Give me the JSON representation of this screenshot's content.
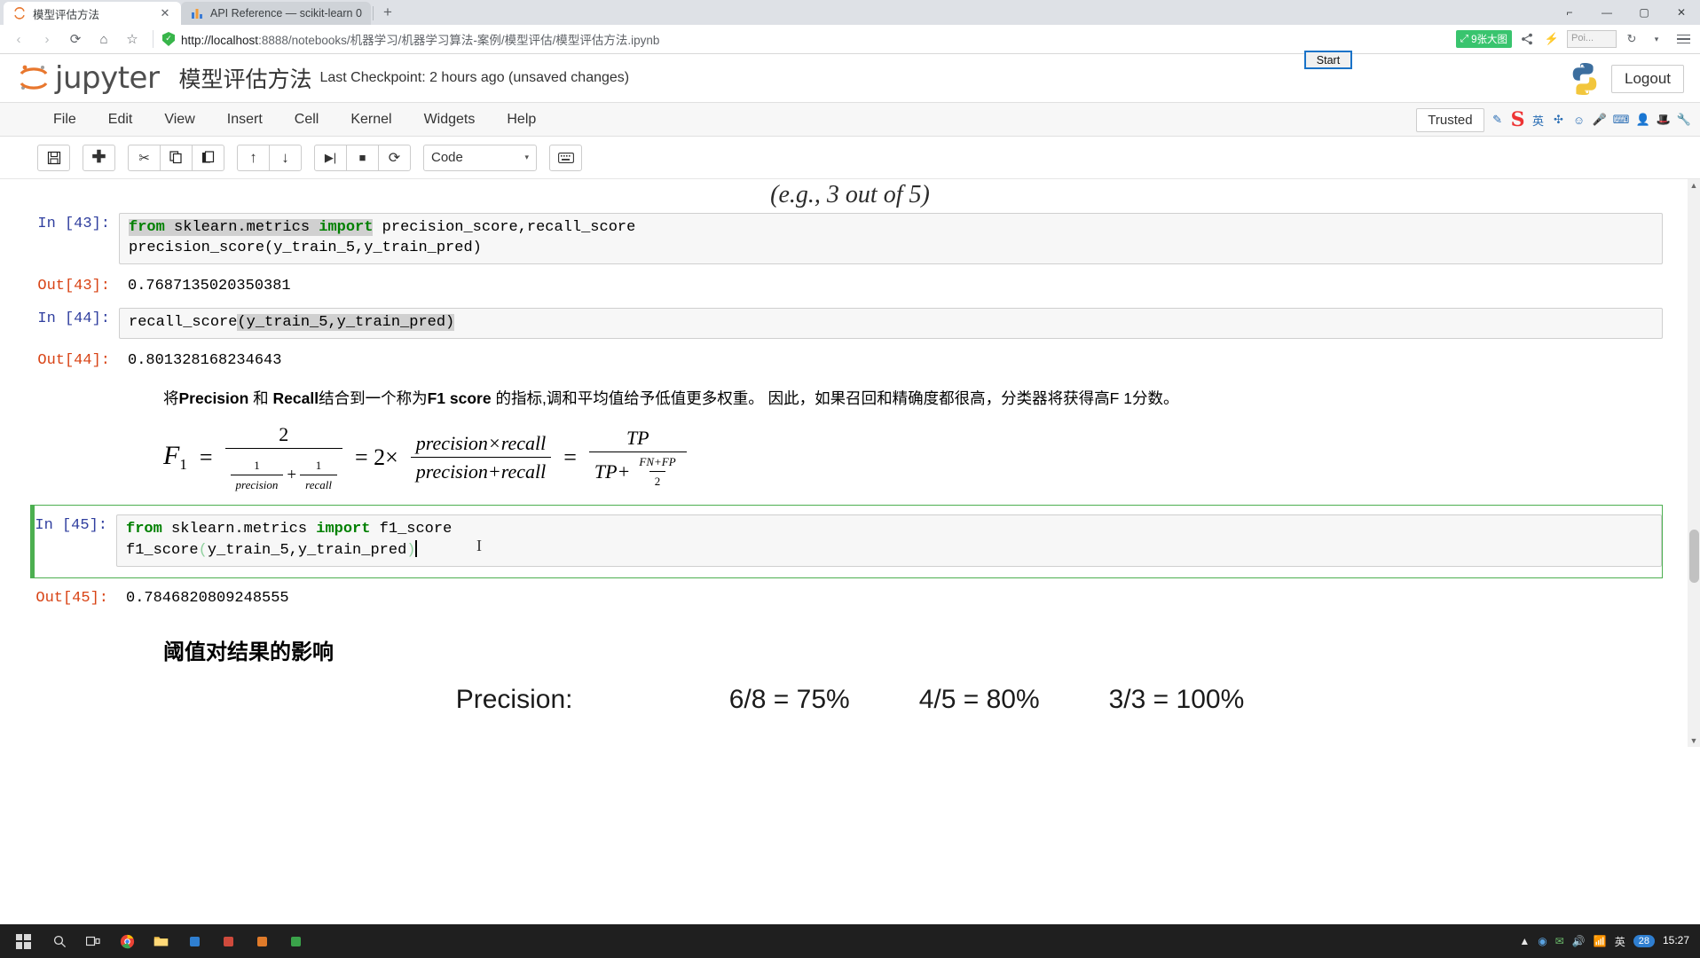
{
  "browser": {
    "tabs": [
      {
        "title": "模型评估方法",
        "favicon": "jupyter-icon",
        "active": true,
        "close_label": "✕"
      },
      {
        "title": "API Reference — scikit-learn 0",
        "favicon": "chart-icon",
        "active": false,
        "close_label": ""
      }
    ],
    "new_tab_label": "+",
    "window_buttons": {
      "minimize": "—",
      "maximize": "▢",
      "close": "✕",
      "restore": "⌐"
    },
    "nav": {
      "back": "‹",
      "forward": "›",
      "reload": "⟳",
      "home": "⌂",
      "bookmark": "☆"
    },
    "address": {
      "security_icon": "shield-check-icon",
      "host": "http://localhost",
      "rest": ":8888/notebooks/机器学习/机器学习算法-案例/模型评估/模型评估方法.ipynb",
      "full_url": "http://localhost:8888/notebooks/机器学习/机器学习算法-案例/模型评估/模型评估方法.ipynb"
    },
    "toolbar_right": {
      "capture_badge": "9张大图",
      "capture_icon": "expand-icon",
      "share_icon": "share-icon",
      "flash_icon": "lightning-icon",
      "poi_text": "Poi...",
      "history_icon": "history-icon",
      "menu_icon": "hamburger-menu-icon"
    }
  },
  "overlay": {
    "start_button": "Start"
  },
  "jupyter": {
    "logo_text": "jupyter",
    "notebook_title": "模型评估方法",
    "checkpoint": "Last Checkpoint: 2 hours ago (unsaved changes)",
    "logout_label": "Logout",
    "menus": [
      "File",
      "Edit",
      "View",
      "Insert",
      "Cell",
      "Kernel",
      "Widgets",
      "Help"
    ],
    "trusted_label": "Trusted",
    "kernel_icon": "python-logo-icon",
    "toolbar": {
      "buttons": [
        {
          "name": "save-button",
          "glyph": "💾",
          "title": "Save"
        },
        {
          "name": "insert-cell-button",
          "glyph": "✚",
          "title": "Insert cell below"
        },
        {
          "name": "cut-cell-button",
          "glyph": "✂",
          "title": "Cut"
        },
        {
          "name": "copy-cell-button",
          "glyph": "⧉",
          "title": "Copy"
        },
        {
          "name": "paste-cell-button",
          "glyph": "📋",
          "title": "Paste"
        },
        {
          "name": "move-up-button",
          "glyph": "↑",
          "title": "Move up"
        },
        {
          "name": "move-down-button",
          "glyph": "↓",
          "title": "Move down"
        },
        {
          "name": "run-cell-button",
          "glyph": "▶|",
          "title": "Run"
        },
        {
          "name": "interrupt-kernel-button",
          "glyph": "■",
          "title": "Interrupt"
        },
        {
          "name": "restart-kernel-button",
          "glyph": "⟳",
          "title": "Restart"
        }
      ],
      "cell_type": "Code",
      "caret": "▾",
      "keyboard_icon": "keyboard-icon"
    },
    "ime": {
      "logo": "S",
      "lang": "英",
      "items": [
        "✣",
        "☺",
        "🎤",
        "⌨",
        "👤",
        "🎩",
        "🔧"
      ]
    }
  },
  "notebook": {
    "top_fragment": "(e.g., 3 out of 5)",
    "cells": [
      {
        "id": "cell-43",
        "prompt_in": "In [43]:",
        "prompt_out": "Out[43]:",
        "code_line1_kw1": "from",
        "code_line1_mid": " sklearn.metrics ",
        "code_line1_kw2": "import",
        "code_line1_tail": " precision_score,recall_score",
        "code_line2": "precision_score(y_train_5,y_train_pred)",
        "output": "0.7687135020350381",
        "selected": false
      },
      {
        "id": "cell-44",
        "prompt_in": "In [44]:",
        "prompt_out": "Out[44]:",
        "code_head": "recall_score",
        "code_selected": "(y_train_5,y_train_pred)",
        "output": "0.801328168234643",
        "selected": false
      },
      {
        "id": "cell-45",
        "prompt_in": "In [45]:",
        "prompt_out": "Out[45]:",
        "code_line1_kw1": "from",
        "code_line1_mid": " sklearn.metrics ",
        "code_line1_kw2": "import",
        "code_line1_tail": " f1_score",
        "code_line2_head": "f1_score",
        "code_line2_paren_open": "(",
        "code_line2_args": "y_train_5,y_train_pred",
        "code_line2_paren_close": ")",
        "output": "0.7846820809248555",
        "selected": true
      }
    ],
    "markdown": {
      "p1_a": "将",
      "p1_b": "Precision",
      "p1_c": " 和 ",
      "p1_d": "Recall",
      "p1_e": "结合到一个称为",
      "p1_f": "F1 score",
      "p1_g": " 的指标,调和平均值给予低值更多权重。 因此，如果召回和精确度都很高，分类器将获得高F 1分数。",
      "heading2": "阈值对结果的影响"
    },
    "formula": {
      "lhs_sym": "F",
      "lhs_sub": "1",
      "eq1": "=",
      "frac1_num": "2",
      "frac1_den_a": "1",
      "frac1_den_a2": "precision",
      "frac1_plus": "+",
      "frac1_den_b": "1",
      "frac1_den_b2": "recall",
      "eq2": "= 2×",
      "frac2_num": "precision×recall",
      "frac2_den": "precision+recall",
      "eq3": "=",
      "frac3_num": "TP",
      "frac3_den_a": "TP+",
      "frac3_den_b_num": "FN+FP",
      "frac3_den_b_den": "2"
    },
    "bottom_image": {
      "row1_label": "Precision:",
      "row1_values": [
        "6/8 = 75%",
        "4/5 = 80%",
        "3/3 = 100%"
      ]
    }
  },
  "taskbar": {
    "start_icon": "windows-logo-icon",
    "left_icons": [
      "search-icon",
      "taskview-icon",
      "chrome-icon",
      "explorer-icon",
      "app1-icon",
      "app2-icon",
      "app3-icon",
      "app4-icon"
    ],
    "tray_icons": [
      "tray1-icon",
      "tray2-icon",
      "tray3-icon",
      "tray4-icon",
      "tray5-icon"
    ],
    "tray_lang": "英",
    "tray_badge": "28",
    "clock_time": "15:27"
  }
}
